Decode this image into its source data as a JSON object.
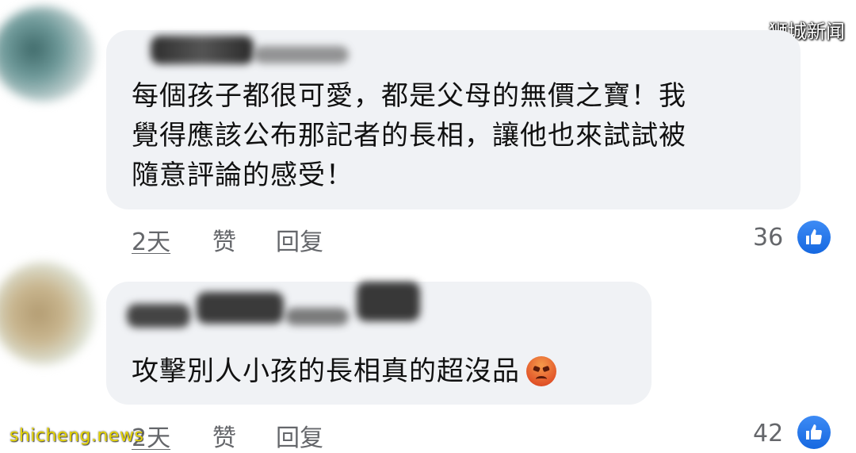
{
  "watermarks": {
    "top_right": "狮城新闻",
    "bottom_left": "shicheng.news"
  },
  "comments": [
    {
      "text": "每個孩子都很可愛，都是父母的無價之寶！我\n覺得應該公布那記者的長相，讓他也來試試被\n隨意評論的感受！",
      "time": "2天",
      "like_label": "赞",
      "reply_label": "回复",
      "reaction_count": "36"
    },
    {
      "text": "攻擊別人小孩的長相真的超沒品",
      "emoji": "angry-face",
      "time": "2天",
      "like_label": "赞",
      "reply_label": "回复",
      "reaction_count": "42"
    }
  ],
  "colors": {
    "bubble": "#f0f2f5",
    "meta_text": "#65676b",
    "like_blue": "#1877f2"
  }
}
